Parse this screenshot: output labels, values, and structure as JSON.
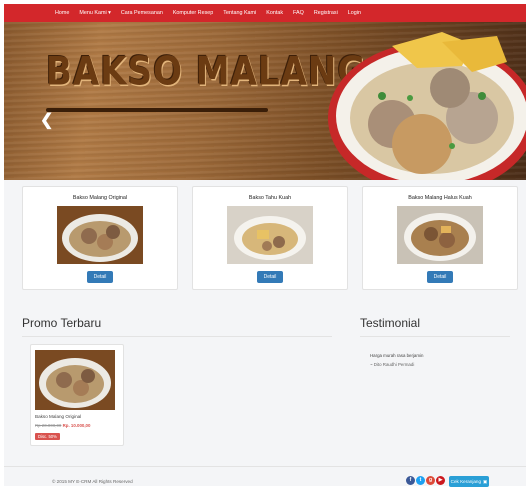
{
  "nav": {
    "items": [
      {
        "label": "Home"
      },
      {
        "label": "Menu Kami ▾"
      },
      {
        "label": "Cara Pemesanan"
      },
      {
        "label": "Komputer Resep"
      },
      {
        "label": "Tentang Kami"
      },
      {
        "label": "Kontak"
      },
      {
        "label": "FAQ"
      },
      {
        "label": "Registrasi"
      },
      {
        "label": "Login"
      }
    ]
  },
  "hero": {
    "title": "BAKSO MALANG",
    "prev_icon": "chevron-left-icon"
  },
  "products": [
    {
      "name": "Bakso Malang Original",
      "button": "Detail"
    },
    {
      "name": "Bakso Tahu Kuah",
      "button": "Detail"
    },
    {
      "name": "Bakso Malang Halus Kuah",
      "button": "Detail"
    }
  ],
  "promo": {
    "heading": "Promo Terbaru",
    "item": {
      "name": "Bakso Malang Original",
      "old_price": "Rp 20.000,00",
      "new_price": "Rp. 10.000,00",
      "badge": "Disc. 50%"
    }
  },
  "testimonial": {
    "heading": "Testimonial",
    "quote": "Harga murah rasa berjamin",
    "author": "~ Dito Raudhi Permadi"
  },
  "footer": {
    "copyright": "© 2015 MY E-CRM All Rights Reserved",
    "social": [
      {
        "name": "facebook-icon",
        "glyph": "f",
        "color": "#3b5998"
      },
      {
        "name": "twitter-icon",
        "glyph": "t",
        "color": "#1da1f2"
      },
      {
        "name": "google-plus-icon",
        "glyph": "g",
        "color": "#dd4b39"
      },
      {
        "name": "youtube-icon",
        "glyph": "▶",
        "color": "#cc181e"
      }
    ],
    "cart_label": "Cek Keranjang"
  }
}
